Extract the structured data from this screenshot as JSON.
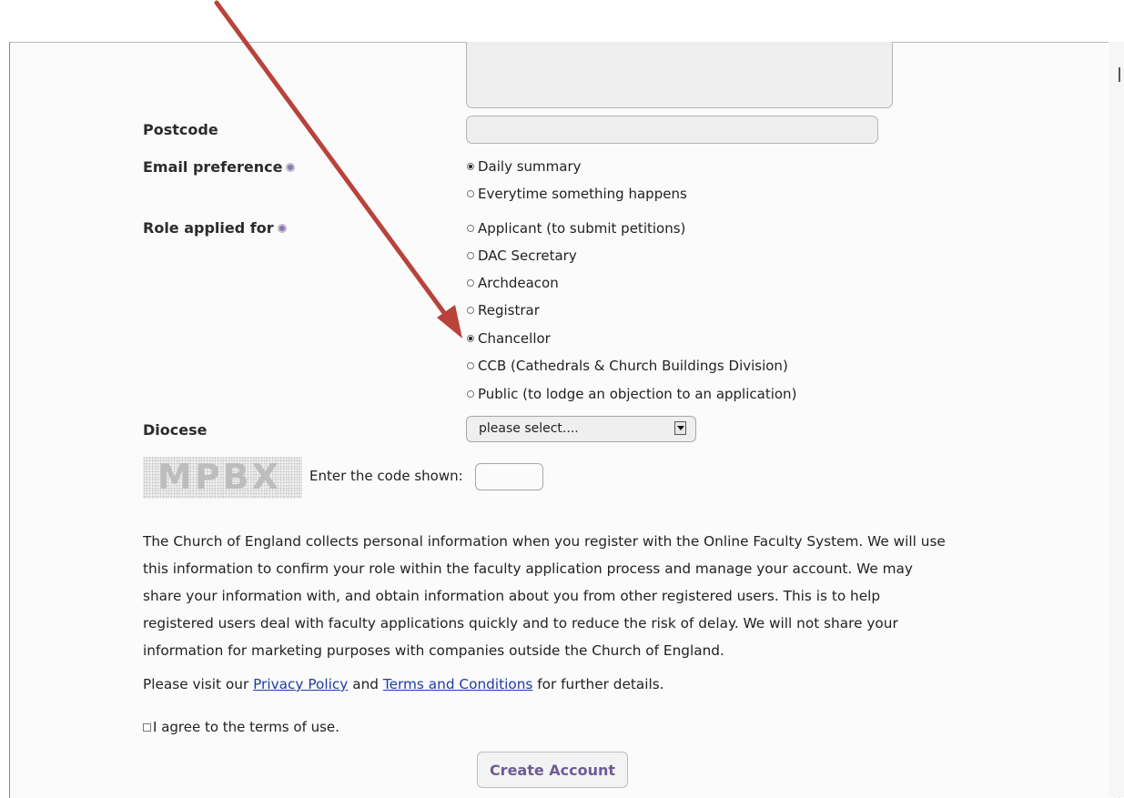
{
  "form": {
    "postcode_label": "Postcode",
    "email_pref_label": "Email preference",
    "email_options": [
      {
        "label": "Daily summary",
        "checked": true
      },
      {
        "label": "Everytime something happens",
        "checked": false
      }
    ],
    "role_label": "Role applied for",
    "role_options": [
      {
        "label": "Applicant (to submit petitions)",
        "checked": false
      },
      {
        "label": "DAC Secretary",
        "checked": false
      },
      {
        "label": "Archdeacon",
        "checked": false
      },
      {
        "label": "Registrar",
        "checked": false
      },
      {
        "label": "Chancellor",
        "checked": true
      },
      {
        "label": "CCB (Cathedrals & Church Buildings Division)",
        "checked": false
      },
      {
        "label": "Public (to lodge an objection to an application)",
        "checked": false
      }
    ],
    "diocese_label": "Diocese",
    "diocese_selected": "please select....",
    "captcha_text": "MPBX",
    "code_label": "Enter the code shown:",
    "privacy_paragraph": "The Church of England collects personal information when you register with the Online Faculty System. We will use this information to confirm your role within the faculty application process and manage your account. We may share your information with, and obtain information about you from other registered users. This is to help registered users deal with faculty applications quickly and to reduce the risk of delay. We will not share your information for marketing purposes with companies outside the Church of England.",
    "visit_prefix": "Please visit our ",
    "privacy_link": "Privacy Policy",
    "visit_and": " and ",
    "terms_link": "Terms and Conditions",
    "visit_suffix": " for further details.",
    "agree_label": "I agree to the terms of use.",
    "create_button": "Create Account"
  },
  "colors": {
    "annotation_arrow": "#b8433b",
    "button_text": "#6e5b96",
    "link": "#1f3ca8"
  }
}
